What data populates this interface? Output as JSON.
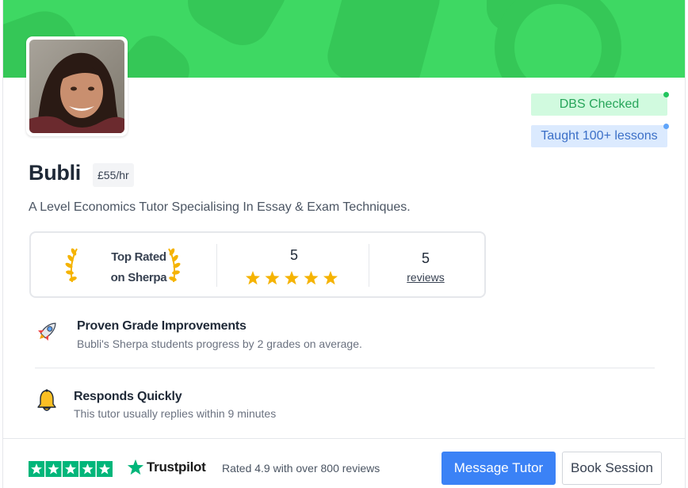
{
  "profile": {
    "name": "Bubli",
    "rate": "£55/hr",
    "headline": "A Level Economics Tutor Specialising In Essay & Exam Techniques."
  },
  "badges": {
    "dbs": "DBS Checked",
    "taught": "Taught 100+ lessons"
  },
  "stats": {
    "top_rated_line1": "Top Rated",
    "top_rated_line2": "on Sherpa",
    "rating": "5",
    "stars": 5,
    "review_count": "5",
    "reviews_label": "reviews"
  },
  "features": [
    {
      "icon": "rocket-icon",
      "title": "Proven Grade Improvements",
      "desc": "Bubli's Sherpa students progress by 2 grades on average."
    },
    {
      "icon": "bell-icon",
      "title": "Responds Quickly",
      "desc": "This tutor usually replies within 9 minutes"
    }
  ],
  "footer": {
    "trustpilot_name": "Trustpilot",
    "trustpilot_text": "Rated 4.9 with over 800 reviews",
    "message_button": "Message Tutor",
    "book_button": "Book Session"
  },
  "colors": {
    "banner": "#3ed863",
    "primary_button": "#3b82f6",
    "trustpilot_green": "#00b67a",
    "star_gold": "#f5b301"
  }
}
